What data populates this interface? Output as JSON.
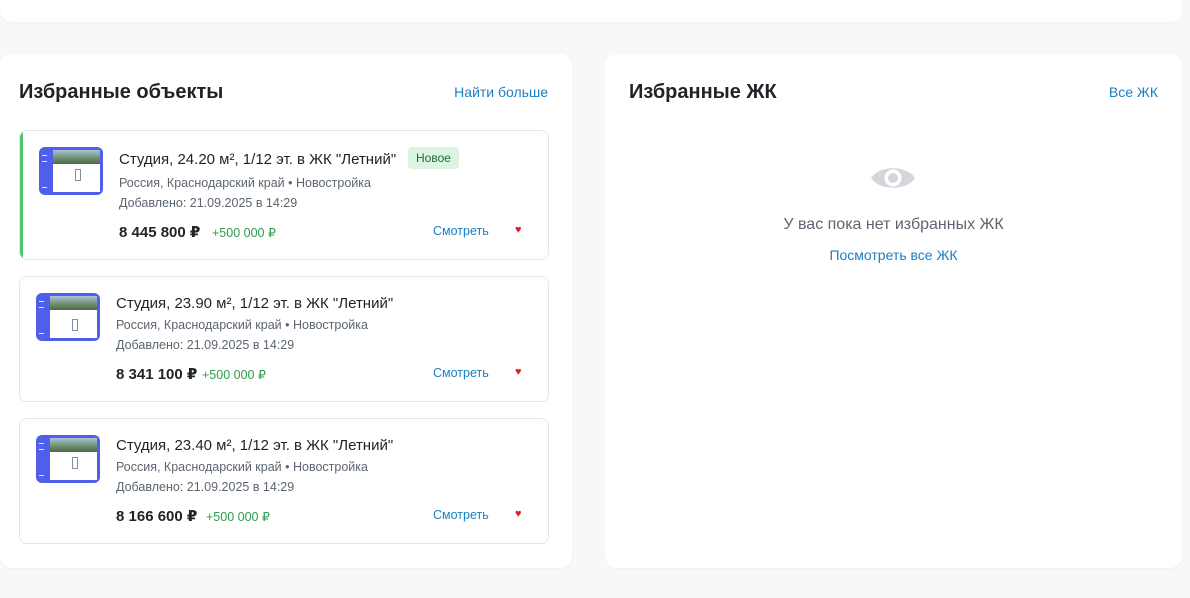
{
  "favorites_objects": {
    "title": "Избранные объекты",
    "more_link": "Найти больше",
    "items": [
      {
        "title": "Студия, 24.20 м², 1/12 эт. в ЖК \"Летний\"",
        "badge": "Новое",
        "location": "Россия, Краснодарский край • Новостройка",
        "added": "Добавлено: 21.09.2025 в 14:29",
        "price": "8 445 800 ₽",
        "delta": "+500 000 ₽",
        "view_label": "Смотреть",
        "heart": "♥"
      },
      {
        "title": "Студия, 23.90 м², 1/12 эт. в ЖК \"Летний\"",
        "location": "Россия, Краснодарский край • Новостройка",
        "added": "Добавлено: 21.09.2025 в 14:29",
        "price": "8 341 100 ₽",
        "delta": "+500 000 ₽",
        "view_label": "Смотреть",
        "heart": "♥"
      },
      {
        "title": "Студия, 23.40 м², 1/12 эт. в ЖК \"Летний\"",
        "location": "Россия, Краснодарский край • Новостройка",
        "added": "Добавлено: 21.09.2025 в 14:29",
        "price": "8 166 600 ₽",
        "delta": "+500 000 ₽",
        "view_label": "Смотреть",
        "heart": "♥"
      }
    ]
  },
  "favorites_complexes": {
    "title": "Избранные ЖК",
    "all_link": "Все ЖК",
    "empty_icon": "eye-icon",
    "empty_text": "У вас пока нет избранных ЖК",
    "empty_link": "Посмотреть все ЖК"
  },
  "colors": {
    "accent_link": "#1a7fc1",
    "new_accent": "#4cc66e",
    "price_delta": "#2e9d4b",
    "heart": "#d6212f",
    "thumb_bg": "#4f5fe8"
  }
}
